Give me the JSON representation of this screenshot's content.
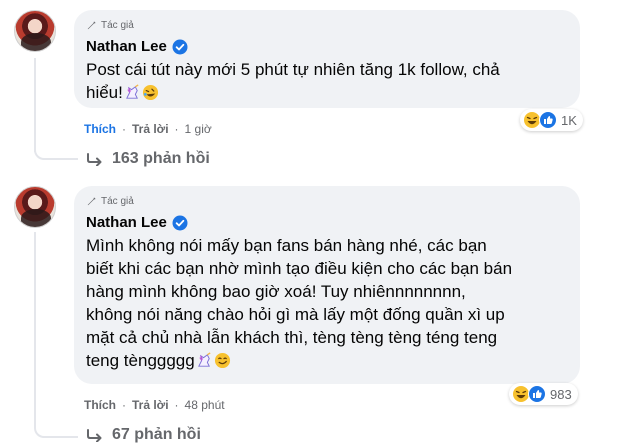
{
  "comments": [
    {
      "badge": "Tác giả",
      "author": "Nathan Lee",
      "lines": [
        "Post cái tút này mới 5 phút tự nhiên tăng 1k follow, chả",
        "hiểu!"
      ],
      "reaction_count": "1K",
      "like_label": "Thích",
      "reply_label": "Trả lời",
      "time": "1 giờ",
      "replies_label": "163 phản hồi"
    },
    {
      "badge": "Tác giả",
      "author": "Nathan Lee",
      "lines": [
        "Mình không nói mấy bạn fans bán hàng nhé, các bạn",
        "biết khi các bạn nhờ mình tạo điều kiện cho các bạn bán",
        "hàng mình không bao giờ xoá! Tuy nhiênnnnnnnn,",
        "không nói năng chào hỏi gì mà lấy một đống quần xì up",
        "mặt cả chủ nhà lẫn khách thì, tèng tèng tèng téng teng",
        "teng tènggggg"
      ],
      "reaction_count": "983",
      "like_label": "Thích",
      "reply_label": "Trả lời",
      "time": "48 phút",
      "replies_label": "67 phản hồi"
    }
  ],
  "icons": {
    "badge": "pencil-icon",
    "verified": "verified-badge-icon",
    "reply_arrow": "reply-arrow-icon",
    "haha": "haha-reaction-icon",
    "like": "like-reaction-icon",
    "unicorn": "unicorn-emoji-icon",
    "rofl": "rofl-emoji-icon",
    "smile": "smirk-emoji-icon"
  },
  "colors": {
    "accent": "#1b74e4",
    "bubble": "#f0f2f5",
    "muted": "#65676b"
  }
}
